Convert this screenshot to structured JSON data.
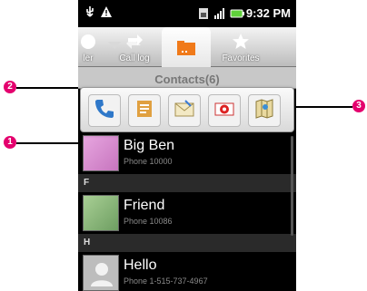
{
  "status_bar": {
    "time": "9:32 PM",
    "icons": [
      "usb-icon",
      "warning-icon",
      "sim-icon",
      "signal-icon",
      "battery-icon"
    ]
  },
  "tabs": [
    {
      "label": "ler",
      "icon": "dialer-icon"
    },
    {
      "label": "Call log",
      "icon": "call-log-icon"
    },
    {
      "label": "",
      "icon": "contacts-folder-icon",
      "active": true
    },
    {
      "label": "Favorites",
      "icon": "star-icon"
    }
  ],
  "header": {
    "title": "Contacts(6)"
  },
  "quick_contact": {
    "actions": [
      "call-icon",
      "message-icon",
      "email-icon",
      "gmail-icon",
      "map-icon"
    ]
  },
  "contacts": [
    {
      "name": "Big Ben",
      "phone": "Phone 10000",
      "avatar_color": "#d98fd0"
    },
    {
      "section": "F"
    },
    {
      "name": "Friend",
      "phone": "Phone 10086",
      "avatar_color": "#9cc48a"
    },
    {
      "section": "H"
    },
    {
      "name": "Hello",
      "phone": "Phone 1-515-737-4967",
      "avatar_color": "#bdbdbd"
    }
  ],
  "callouts": [
    {
      "number": "1"
    },
    {
      "number": "2"
    },
    {
      "number": "3"
    }
  ]
}
